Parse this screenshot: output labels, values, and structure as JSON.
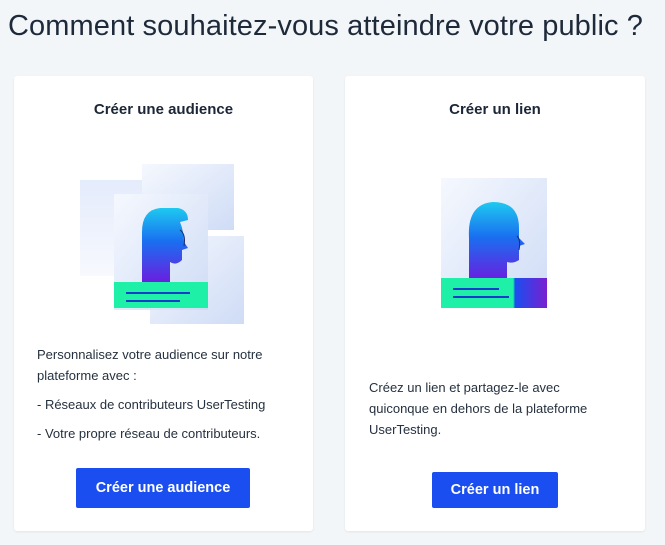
{
  "page": {
    "title": "Comment souhaitez-vous atteindre votre public ?"
  },
  "cards": {
    "audience": {
      "title": "Créer une audience",
      "intro": "Personnalisez votre audience sur notre plateforme avec :",
      "bullets": [
        "- Réseaux de contributeurs UserTesting",
        "- Votre propre réseau de contributeurs."
      ],
      "button_label": "Créer une audience",
      "illustration_icon": "audience-profile-cards-icon"
    },
    "link": {
      "title": "Créer un lien",
      "description": "Créez un lien et partagez-le avec quiconque en dehors de la plateforme UserTesting.",
      "button_label": "Créer un lien",
      "illustration_icon": "single-profile-card-icon"
    }
  },
  "colors": {
    "background": "#f3f6f8",
    "card": "#ffffff",
    "primary_button": "#1a4ef0",
    "accent_green": "#1ef0a8",
    "accent_blue": "#1a4ef0",
    "accent_purple": "#7a1fd0"
  }
}
